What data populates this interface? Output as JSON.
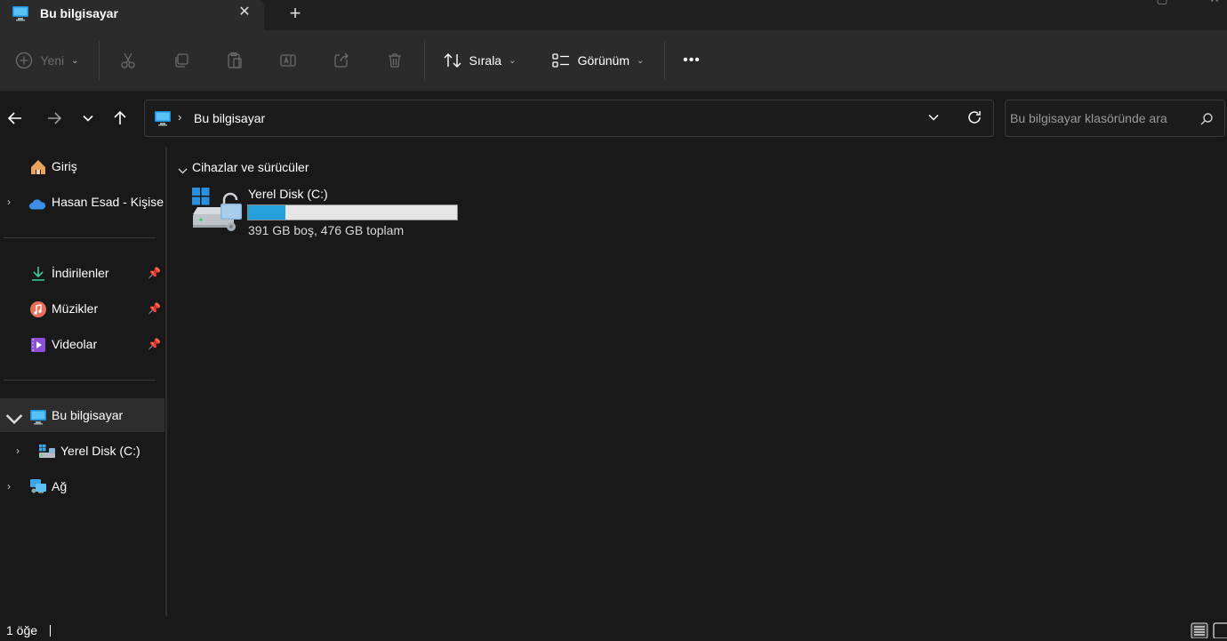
{
  "window": {
    "tab_title": "Bu bilgisayar",
    "new_tab_label": "+",
    "close_tab_label": "✕"
  },
  "toolbar": {
    "new_label": "Yeni",
    "sort_label": "Sırala",
    "view_label": "Görünüm",
    "more_label": "•••"
  },
  "address": {
    "crumb": "Bu bilgisayar",
    "search_placeholder": "Bu bilgisayar klasöründe ara"
  },
  "sidebar": {
    "items": [
      {
        "label": "Giriş",
        "icon": "home-icon"
      },
      {
        "label": "Hasan Esad - Kişise",
        "icon": "onedrive-icon"
      },
      {
        "label": "İndirilenler",
        "icon": "download-icon",
        "pinned": true
      },
      {
        "label": "Müzikler",
        "icon": "music-icon",
        "pinned": true
      },
      {
        "label": "Videolar",
        "icon": "video-icon",
        "pinned": true
      },
      {
        "label": "Bu bilgisayar",
        "icon": "computer-icon",
        "selected": true
      },
      {
        "label": "Yerel Disk (C:)",
        "icon": "drive-icon"
      },
      {
        "label": "Ağ",
        "icon": "network-icon"
      }
    ]
  },
  "content": {
    "section_title": "Cihazlar ve sürücüler",
    "drives": [
      {
        "name": "Yerel Disk (C:)",
        "info": "391 GB boş, 476 GB toplam",
        "used_fraction": 0.18
      }
    ]
  },
  "status": {
    "item_count": "1 öğe"
  },
  "colors": {
    "accent": "#26a0da",
    "background": "#191919",
    "toolbar": "#2b2b2b"
  }
}
